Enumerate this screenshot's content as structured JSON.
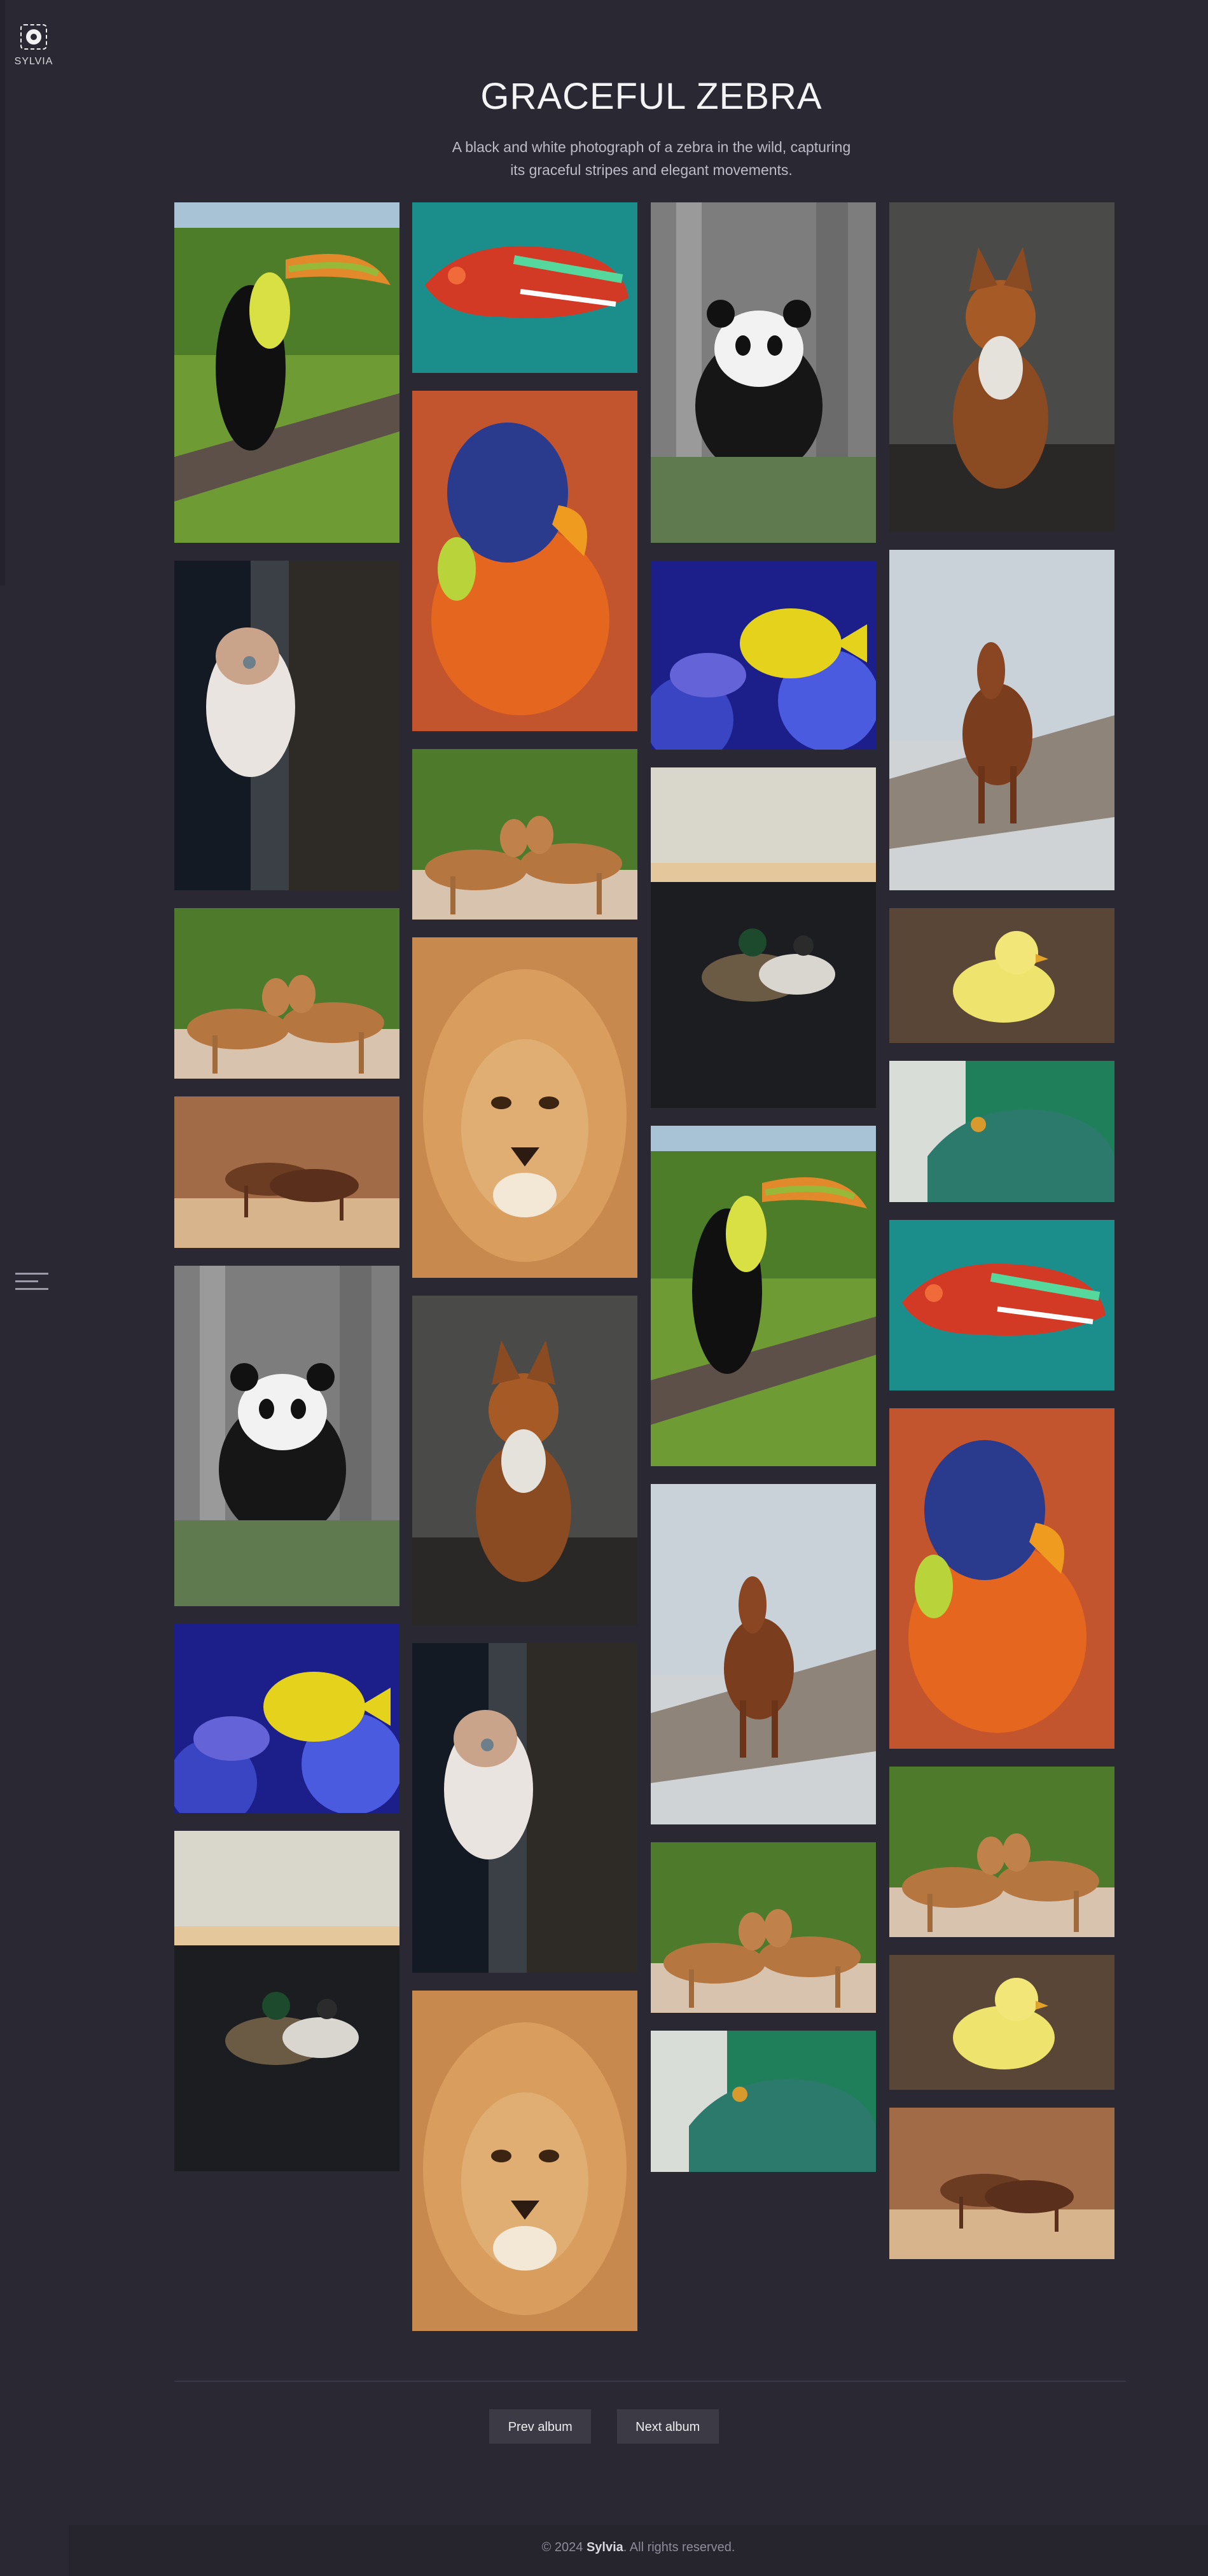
{
  "brand": {
    "name": "SYLVIA",
    "icon": "camera-aperture-icon"
  },
  "menu": {
    "icon": "menu-lines-icon"
  },
  "album": {
    "title": "GRACEFUL ZEBRA",
    "description": "A black and white photograph of a zebra in the wild, capturing its graceful stripes and elegant movements."
  },
  "gallery": {
    "columns": [
      [
        "toucan",
        "kitten",
        "impala",
        "horses",
        "panda",
        "tang-fish",
        "ducks"
      ],
      [
        "chameleon",
        "parrot",
        "impala",
        "lion",
        "fox",
        "kitten",
        "lion"
      ],
      [
        "panda",
        "tang-fish",
        "ducks",
        "toucan",
        "horse",
        "impala",
        "lizard"
      ],
      [
        "fox",
        "horse",
        "duckling",
        "lizard",
        "chameleon",
        "parrot",
        "impala",
        "duckling",
        "horses"
      ]
    ]
  },
  "pagination": {
    "prev_label": "Prev album",
    "next_label": "Next album"
  },
  "footer": {
    "prefix": "© 2024",
    "brand": "Sylvia",
    "suffix": ". All rights reserved."
  },
  "colors": {
    "background": "#2a2833",
    "button": "#3b3a45",
    "footer": "#26242d"
  }
}
